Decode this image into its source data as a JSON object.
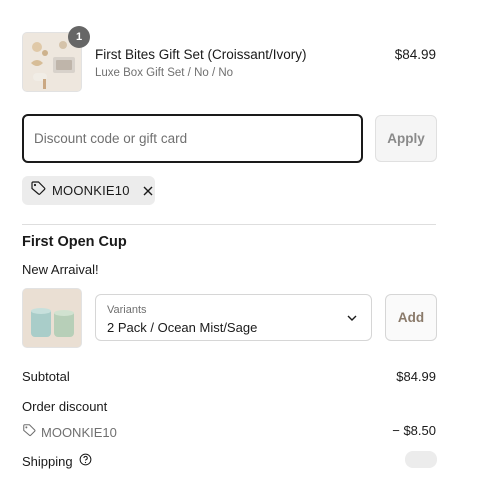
{
  "cart_item": {
    "title": "First Bites Gift Set (Croissant/Ivory)",
    "variant": "Luxe Box Gift Set / No / No",
    "price": "$84.99",
    "quantity": "1",
    "image_icon": "gift-set-product-image"
  },
  "discount": {
    "placeholder": "Discount code or gift card",
    "value": "",
    "apply_label": "Apply",
    "applied_code": "MOONKIE10",
    "tag_icon": "tag-icon",
    "remove_icon": "close-icon"
  },
  "upsell": {
    "title": "First Open Cup",
    "subtitle": "New Arraival!",
    "image_icon": "cup-product-image",
    "variant_label": "Variants",
    "variant_value": "2 Pack / Ocean Mist/Sage",
    "add_label": "Add"
  },
  "summary": {
    "subtotal_label": "Subtotal",
    "subtotal_value": "$84.99",
    "order_discount_label": "Order discount",
    "discount_code": "MOONKIE10",
    "discount_amount": "− $8.50",
    "shipping_label": "Shipping"
  },
  "colors": {
    "text": "#1a1a1a",
    "muted": "#707070",
    "input_border_focus": "#1a1a1a",
    "chip_bg": "#ececec",
    "badge_bg": "#666666"
  }
}
